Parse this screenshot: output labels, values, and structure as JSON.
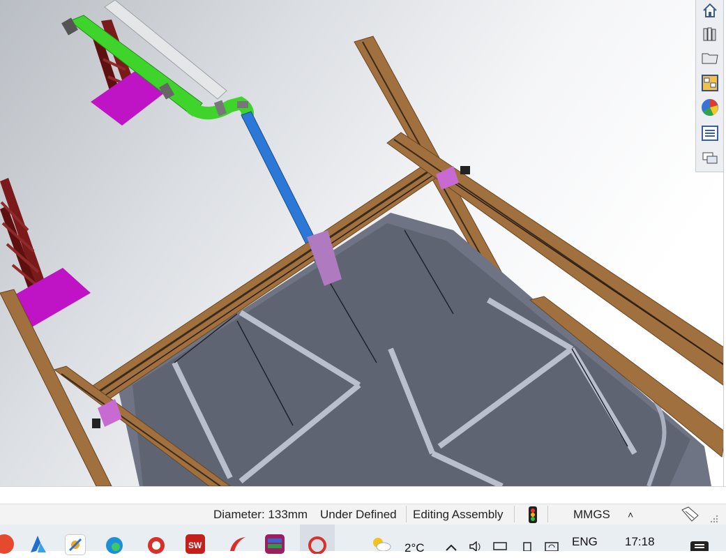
{
  "status_bar": {
    "diameter": "Diameter: 133mm",
    "definition": "Under Defined",
    "mode": "Editing Assembly",
    "units": "MMGS",
    "units_arrow": "˄"
  },
  "taskpane": {
    "buttons": [
      "home-icon",
      "design-library-icon",
      "file-explorer-icon",
      "view-palette-icon",
      "appearances-icon",
      "custom-properties-icon",
      "forum-icon"
    ]
  },
  "taskbar": {
    "weather_temp": "2°C",
    "language": "ENG",
    "time": "17:18"
  },
  "colors": {
    "wood": "#a0703f",
    "trough": "#6f7484",
    "magenta": "#bf14c6",
    "green_pipe": "#3ed42b",
    "blue_pipe": "#2c78d6",
    "truss": "#7a1a1a"
  }
}
